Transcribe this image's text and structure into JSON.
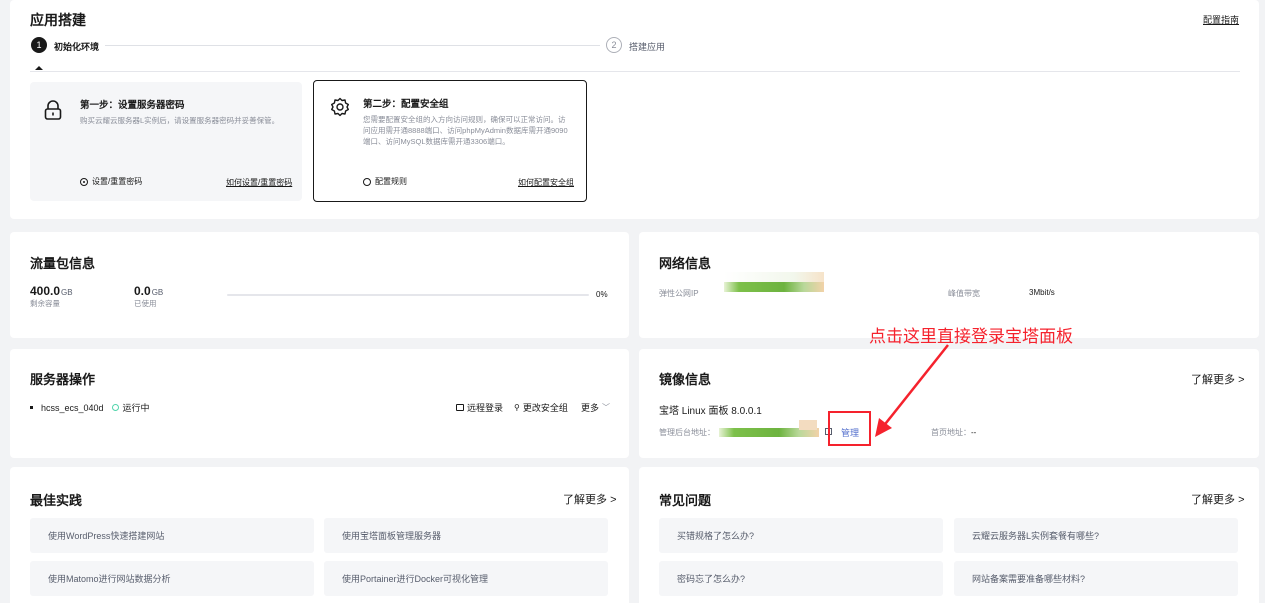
{
  "app_build": {
    "title": "应用搭建",
    "guide_link": "配置指南",
    "steps": [
      {
        "num": "1",
        "label": "初始化环境"
      },
      {
        "num": "2",
        "label": "搭建应用"
      }
    ],
    "cards": [
      {
        "title": "第一步：设置服务器密码",
        "desc": "购买云耀云服务器L实例后，请设置服务器密码并妥善保管。",
        "action": "设置/重置密码",
        "link": "如何设置/重置密码"
      },
      {
        "title": "第二步：配置安全组",
        "desc": "您需要配置安全组的入方向访问规则，确保可以正常访问。访问应用需开通8888端口、访问phpMyAdmin数据库需开通9090端口、访问MySQL数据库需开通3306端口。",
        "action": "配置规则",
        "link": "如何配置安全组"
      }
    ]
  },
  "traffic": {
    "title": "流量包信息",
    "remaining_value": "400.0",
    "remaining_unit": "GB",
    "remaining_label": "剩余容量",
    "used_value": "0.0",
    "used_unit": "GB",
    "used_label": "已使用",
    "percent_text": "0%",
    "percent": 0
  },
  "network": {
    "title": "网络信息",
    "eip_label": "弹性公网IP",
    "bandwidth_label": "峰值带宽",
    "bandwidth_value": "3Mbit/s"
  },
  "annotation": {
    "text": "点击这里直接登录宝塔面板",
    "color": "#f5222d"
  },
  "server_ops": {
    "title": "服务器操作",
    "server_name": "hcss_ecs_040d",
    "status": "运行中",
    "remote_login": "远程登录",
    "change_sg": "更改安全组",
    "more": "更多"
  },
  "image": {
    "title": "镜像信息",
    "more": "了解更多",
    "name": "宝塔 Linux 面板 8.0.0.1",
    "admin_label": "管理后台地址：",
    "manage": "管理",
    "home_label": "首页地址：",
    "home_value": "--"
  },
  "best_practice": {
    "title": "最佳实践",
    "more": "了解更多",
    "items": [
      "使用WordPress快速搭建网站",
      "使用宝塔面板管理服务器",
      "使用Matomo进行网站数据分析",
      "使用Portainer进行Docker可视化管理"
    ]
  },
  "faq": {
    "title": "常见问题",
    "more": "了解更多",
    "items": [
      "买错规格了怎么办?",
      "云耀云服务器L实例套餐有哪些?",
      "密码忘了怎么办?",
      "网站备案需要准备哪些材料?"
    ]
  },
  "colors": {
    "accent": "#0d94ff",
    "link_blue": "#526ecc",
    "running": "#50d4ab",
    "annotation_red": "#f5222d"
  }
}
